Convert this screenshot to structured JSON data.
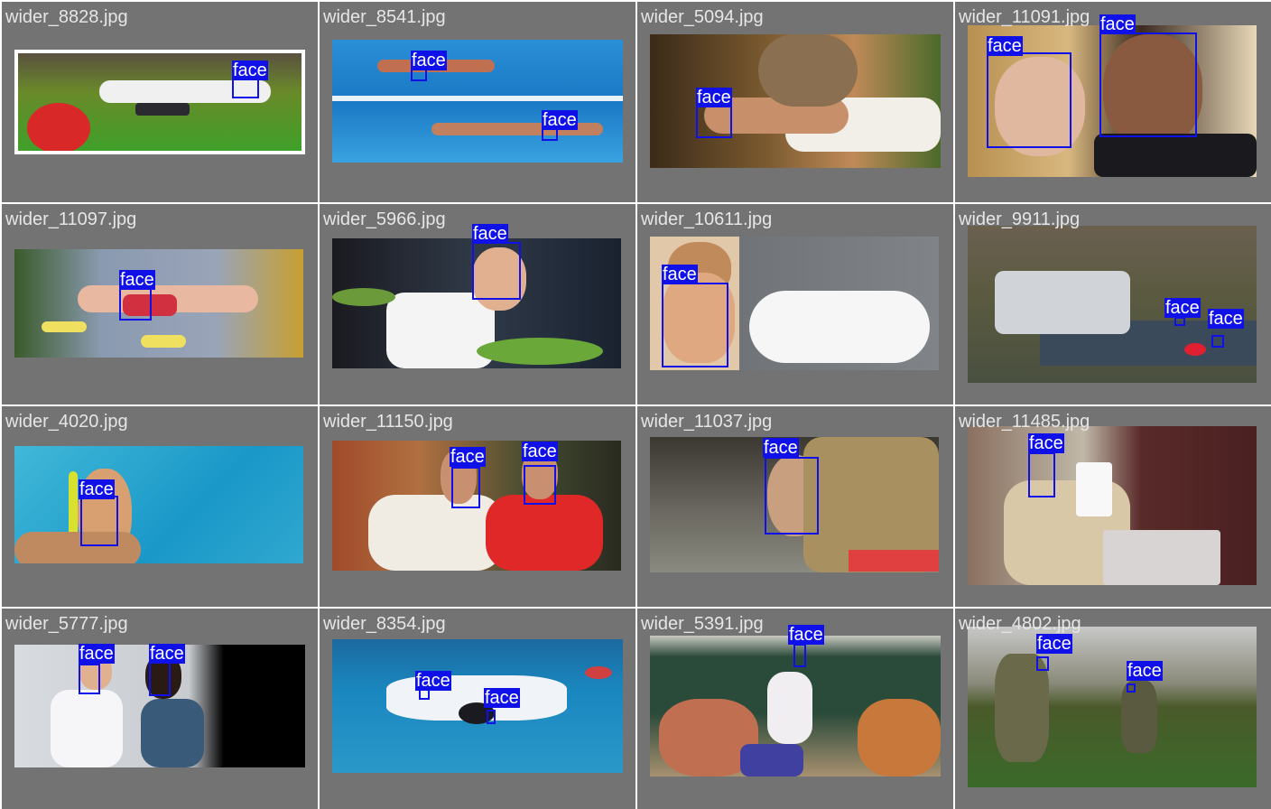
{
  "label_text": "face",
  "colors": {
    "panel": "#737373",
    "filename": "#e6e6e6",
    "box": "#1010e8"
  },
  "images": [
    {
      "file": "wider_8828.jpg",
      "faces": 1
    },
    {
      "file": "wider_8541.jpg",
      "faces": 2
    },
    {
      "file": "wider_5094.jpg",
      "faces": 1
    },
    {
      "file": "wider_11091.jpg",
      "faces": 2
    },
    {
      "file": "wider_11097.jpg",
      "faces": 1
    },
    {
      "file": "wider_5966.jpg",
      "faces": 1
    },
    {
      "file": "wider_10611.jpg",
      "faces": 1
    },
    {
      "file": "wider_9911.jpg",
      "faces": 2
    },
    {
      "file": "wider_4020.jpg",
      "faces": 1
    },
    {
      "file": "wider_11150.jpg",
      "faces": 2
    },
    {
      "file": "wider_11037.jpg",
      "faces": 1
    },
    {
      "file": "wider_11485.jpg",
      "faces": 1
    },
    {
      "file": "wider_5777.jpg",
      "faces": 2
    },
    {
      "file": "wider_8354.jpg",
      "faces": 2
    },
    {
      "file": "wider_5391.jpg",
      "faces": 1
    },
    {
      "file": "wider_4802.jpg",
      "faces": 2
    }
  ]
}
